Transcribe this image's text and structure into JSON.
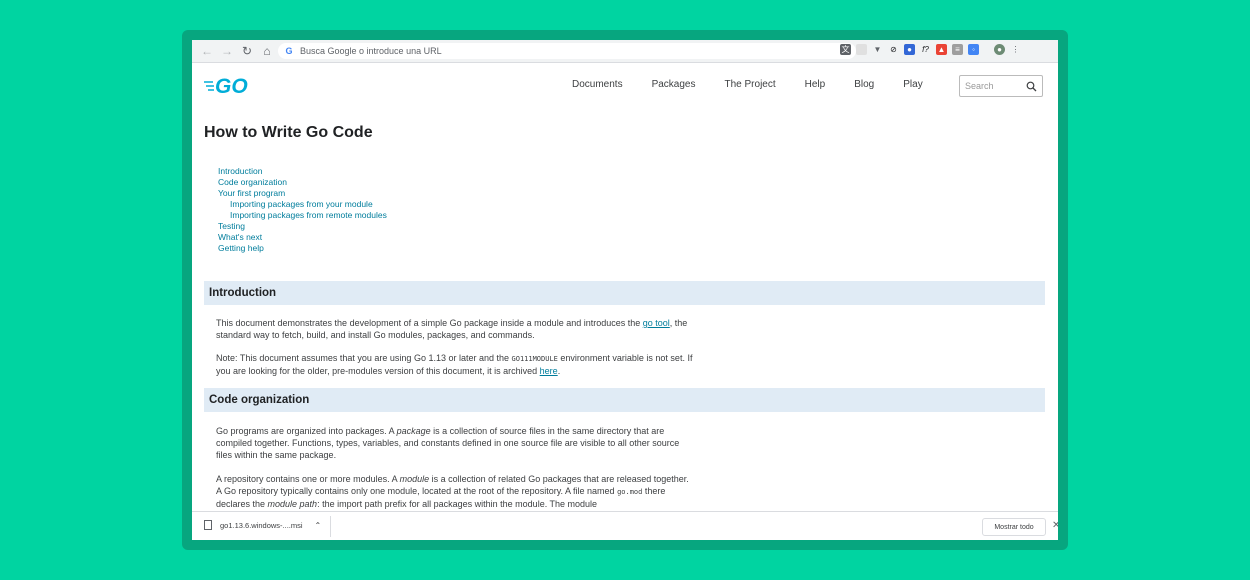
{
  "browser": {
    "address_placeholder": "Busca Google o introduce una URL"
  },
  "site": {
    "logo_text": "GO",
    "nav": [
      "Documents",
      "Packages",
      "The Project",
      "Help",
      "Blog",
      "Play"
    ],
    "search_placeholder": "Search"
  },
  "page": {
    "title": "How to Write Go Code",
    "toc": [
      {
        "label": "Introduction",
        "indent": false
      },
      {
        "label": "Code organization",
        "indent": false
      },
      {
        "label": "Your first program",
        "indent": false
      },
      {
        "label": "Importing packages from your module",
        "indent": true
      },
      {
        "label": "Importing packages from remote modules",
        "indent": true
      },
      {
        "label": "Testing",
        "indent": false
      },
      {
        "label": "What's next",
        "indent": false
      },
      {
        "label": "Getting help",
        "indent": false
      }
    ],
    "intro": {
      "heading": "Introduction",
      "p1_before": "This document demonstrates the development of a simple Go package inside a module and introduces the ",
      "p1_link": "go tool",
      "p1_after": ", the standard way to fetch, build, and install Go modules, packages, and commands.",
      "p2_before": "Note: This document assumes that you are using Go 1.13 or later and the ",
      "p2_code": "GO111MODULE",
      "p2_middle": " environment variable is not set. If you are looking for the older, pre-modules version of this document, it is archived ",
      "p2_link": "here",
      "p2_after": "."
    },
    "code_org": {
      "heading": "Code organization",
      "p1_before": "Go programs are organized into packages. A ",
      "p1_em": "package",
      "p1_after": " is a collection of source files in the same directory that are compiled together. Functions, types, variables, and constants defined in one source file are visible to all other source files within the same package.",
      "p2_before": "A repository contains one or more modules. A ",
      "p2_em": "module",
      "p2_mid1": " is a collection of related Go packages that are released together. A Go repository typically contains only one module, located at the root of the repository. A file named ",
      "p2_code": "go.mod",
      "p2_mid2": " there declares the ",
      "p2_em2": "module path",
      "p2_after": ": the import path prefix for all packages within the module. The module"
    }
  },
  "downloads": {
    "file_name": "go1.13.6.windows-....msi",
    "show_all": "Mostrar todo"
  },
  "colors": {
    "background": "#00d4a1",
    "go_blue": "#00add8",
    "link": "#007d9c",
    "section_bar": "#e0ebf5"
  }
}
